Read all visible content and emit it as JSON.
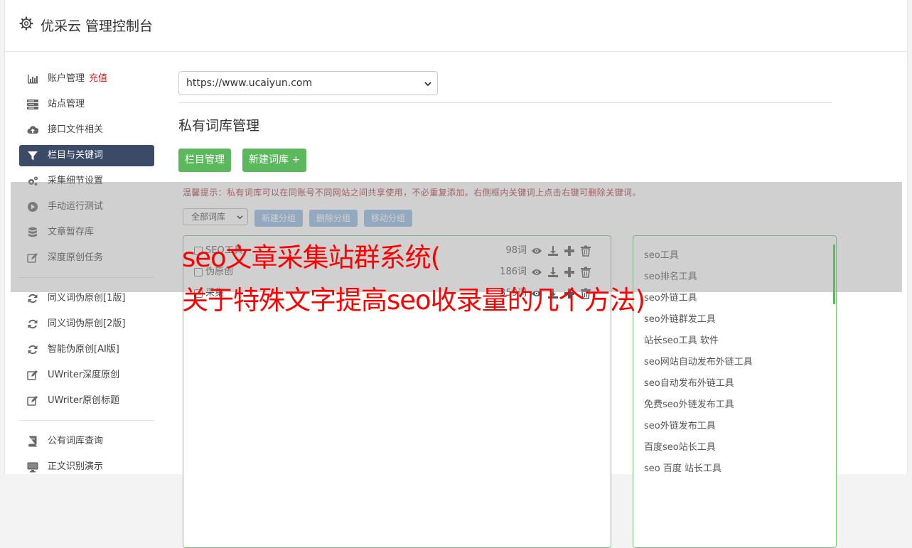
{
  "header": {
    "title": "优采云 管理控制台",
    "icon": "gear-icon"
  },
  "sidebar": {
    "group1": [
      {
        "label": "账户管理",
        "badge": "充值",
        "icon": "bar-chart-icon"
      },
      {
        "label": "站点管理",
        "icon": "server-icon"
      },
      {
        "label": "接口文件相关",
        "icon": "cloud-upload-icon"
      },
      {
        "label": "栏目与关键词",
        "icon": "filter-icon",
        "active": true
      },
      {
        "label": "采集细节设置",
        "icon": "cogs-icon"
      },
      {
        "label": "手动运行测试",
        "icon": "play-icon"
      },
      {
        "label": "文章暂存库",
        "icon": "database-icon"
      },
      {
        "label": "深度原创任务",
        "icon": "edit-icon"
      }
    ],
    "group2": [
      {
        "label": "同义词伪原创[1版]",
        "icon": "refresh-icon"
      },
      {
        "label": "同义词伪原创[2版]",
        "icon": "refresh-icon"
      },
      {
        "label": "智能伪原创[AI版]",
        "icon": "refresh-icon"
      },
      {
        "label": "UWriter深度原创",
        "icon": "edit-icon"
      },
      {
        "label": "UWriter原创标题",
        "icon": "edit-icon"
      }
    ],
    "group3": [
      {
        "label": "公有词库查询",
        "icon": "book-icon"
      },
      {
        "label": "正文识别演示",
        "icon": "monitor-icon"
      }
    ]
  },
  "main": {
    "site_select": "https://www.ucaiyun.com",
    "page_title": "私有词库管理",
    "btn_column": "栏目管理",
    "btn_new_lib": "新建词库 +",
    "tip": "温馨提示：私有词库可以在同账号不同网站之间共享使用，不必重复添加。右侧框内关键词上点击右键可删除关键词。",
    "lib_filter": "全部词库",
    "btn_new_group": "新建分组",
    "btn_del_group": "删除分组",
    "btn_move_group": "移动分组",
    "libraries": [
      {
        "name": "SEO工具",
        "count": "98词"
      },
      {
        "name": "伪原创",
        "count": "186词"
      },
      {
        "name": "采集",
        "count": "359词"
      }
    ],
    "keywords": [
      "seo工具",
      "seo排名工具",
      "seo外链工具",
      "seo外链群发工具",
      "站长seo工具 软件",
      "seo网站自动发布外链工具",
      "seo自动发布外链工具",
      "免费seo外链发布工具",
      "seo外链发布工具",
      "百度seo站长工具",
      "seo 百度 站长工具"
    ]
  },
  "overlay": {
    "line1": "seo文章采集站群系统(",
    "line2": "关于特殊文字提高seo收录量的几个方法)",
    "color": "#ff0000"
  }
}
